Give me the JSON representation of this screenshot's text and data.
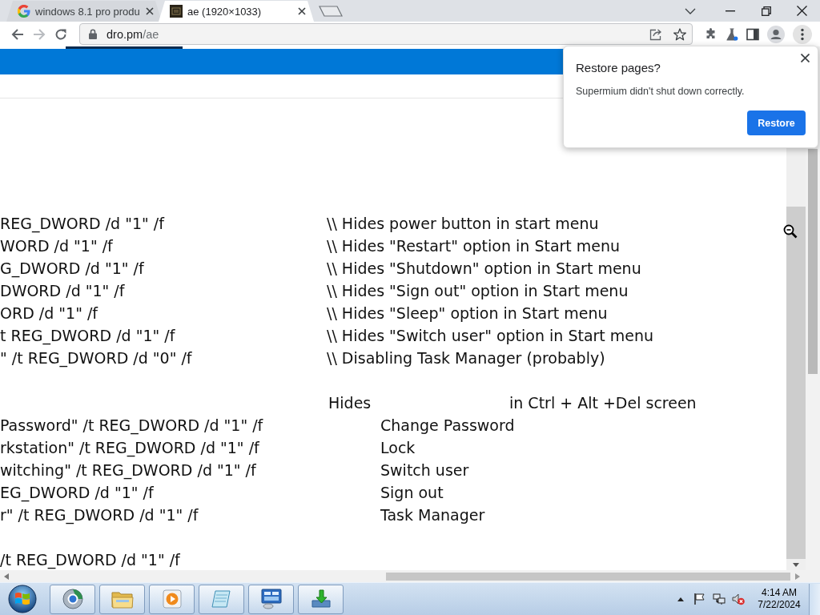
{
  "browser": {
    "tabs": [
      {
        "kind": "search",
        "title": "windows 8.1 pro produ",
        "selected": false
      },
      {
        "kind": "image",
        "title": "ae (1920×1033)",
        "selected": true
      }
    ],
    "nav_buttons": [
      {
        "kind": "back",
        "disabled": false
      },
      {
        "kind": "forward",
        "disabled": true
      },
      {
        "kind": "reload",
        "disabled": false
      }
    ],
    "address": {
      "host": "dro.pm",
      "path": "/ae"
    }
  },
  "page": {
    "start_menu_lines": [
      {
        "command": "REG_DWORD /d \"1\" /f",
        "comment": "\\\\ Hides power button in start menu"
      },
      {
        "command": "WORD /d \"1\" /f",
        "comment": "\\\\ Hides \"Restart\" option in Start menu"
      },
      {
        "command": "G_DWORD /d \"1\" /f",
        "comment": "\\\\ Hides \"Shutdown\" option in Start menu"
      },
      {
        "command": "DWORD /d \"1\" /f",
        "comment": "\\\\ Hides \"Sign out\" option in Start menu"
      },
      {
        "command": "ORD /d \"1\" /f",
        "comment": "\\\\ Hides \"Sleep\" option in Start menu"
      },
      {
        "command": "t REG_DWORD /d \"1\" /f",
        "comment": "\\\\ Hides \"Switch user\" option in Start menu"
      },
      {
        "command": "\" /t REG_DWORD /d \"0\" /f",
        "comment": "\\\\ Disabling Task Manager (probably)"
      }
    ],
    "ctrl_alt_del": {
      "heading": "Hides",
      "heading_end": "in Ctrl + Alt +Del screen",
      "lines": [
        {
          "command": "Password\" /t REG_DWORD /d \"1\" /f",
          "item": "Change Password"
        },
        {
          "command": "rkstation\" /t REG_DWORD /d \"1\" /f",
          "item": "Lock"
        },
        {
          "command": "witching\" /t REG_DWORD /d \"1\" /f",
          "item": "Switch user"
        },
        {
          "command": "EG_DWORD /d \"1\" /f",
          "item": "Sign out"
        },
        {
          "command": "r\" /t REG_DWORD /d \"1\" /f",
          "item": "Task Manager"
        }
      ]
    },
    "trailing_line": "/t REG_DWORD /d \"1\" /f"
  },
  "restore_popup": {
    "title": "Restore pages?",
    "message": "Supermium didn't shut down correctly.",
    "button": "Restore"
  },
  "taskbar": {
    "time": "4:14 AM",
    "date": "7/22/2024"
  }
}
